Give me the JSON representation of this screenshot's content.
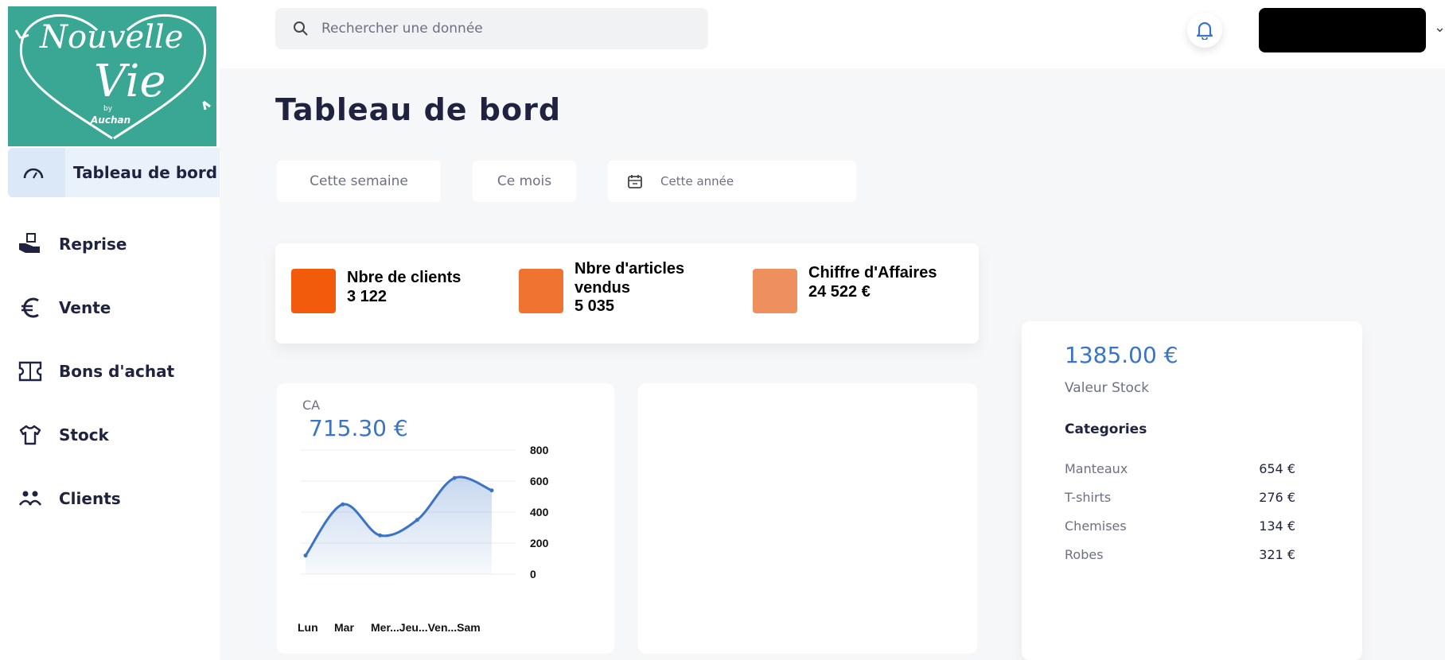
{
  "brand": {
    "line1": "Nouvelle",
    "line2": "Vie",
    "by": "by",
    "name": "Auchan",
    "color": "#3aa795"
  },
  "sidebar": {
    "items": [
      {
        "label": "Tableau de bord",
        "icon": "gauge-icon",
        "active": true
      },
      {
        "label": "Reprise",
        "icon": "hand-box-icon"
      },
      {
        "label": "Vente",
        "icon": "euro-icon"
      },
      {
        "label": "Bons d'achat",
        "icon": "voucher-icon"
      },
      {
        "label": "Stock",
        "icon": "tshirt-icon"
      },
      {
        "label": "Clients",
        "icon": "users-icon"
      }
    ]
  },
  "header": {
    "search_placeholder": "Rechercher une donnée",
    "icons": [
      "search-icon",
      "bell-icon",
      "chevron-down-icon"
    ]
  },
  "page": {
    "title": "Tableau de bord"
  },
  "filters": {
    "week": "Cette semaine",
    "month": "Ce mois",
    "year": "Cette année"
  },
  "kpis": [
    {
      "label": "Nbre de clients",
      "value": "3 122",
      "color": "#f25a0c"
    },
    {
      "label_line1": "Nbre d'articles",
      "label_line2": "vendus",
      "value": "5 035",
      "color": "#ef7431"
    },
    {
      "label": "Chiffre d'Affaires",
      "value": "24 522 €",
      "color": "#ee8f5e"
    }
  ],
  "ca_card": {
    "label": "CA",
    "value": "715.30 €"
  },
  "stock_card": {
    "value": "1385.00 €",
    "label": "Valeur Stock",
    "categories_title": "Categories",
    "categories": [
      {
        "name": "Manteaux",
        "value": "654 €"
      },
      {
        "name": "T-shirts",
        "value": "276 €"
      },
      {
        "name": "Chemises",
        "value": "134 €"
      },
      {
        "name": "Robes",
        "value": "321 €"
      }
    ]
  },
  "accent_color": "#3b73c8",
  "chart_data": {
    "type": "area",
    "categories": [
      "Lun",
      "Mar",
      "Mer...",
      "Jeu...",
      "Ven...",
      "Sam"
    ],
    "values": [
      120,
      450,
      250,
      350,
      620,
      540
    ],
    "y_ticks": [
      "800",
      "600",
      "400",
      "200",
      "0"
    ],
    "x_tick_text": [
      "Lun",
      "Mar",
      "Mer...Jeu...Ven...Sam"
    ],
    "ylim": [
      0,
      800
    ],
    "grid": true,
    "axis_position": "right",
    "color": "#3b73c8"
  }
}
